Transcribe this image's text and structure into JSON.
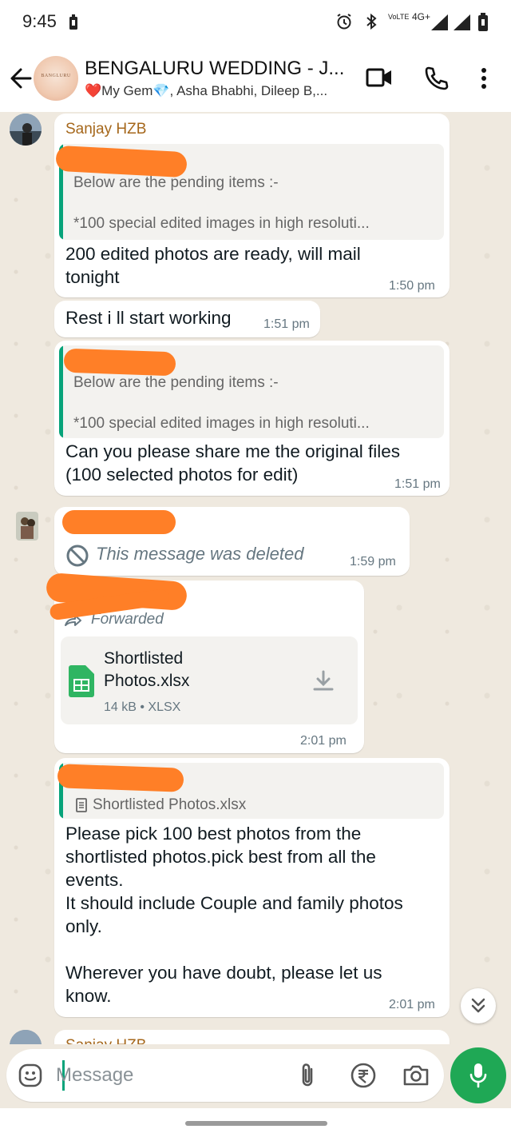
{
  "status_bar": {
    "time": "9:45",
    "network": "4G+",
    "volte": "VoLTE"
  },
  "header": {
    "title": "BENGALURU WEDDING - J...",
    "subtitle": "❤️My Gem💎, Asha Bhabhi, Dileep B,...",
    "avatar_text": "BANGLURU"
  },
  "messages": [
    {
      "sender": "Sanjay HZB",
      "quote_line1": "Below are the pending items :-",
      "quote_line2": "*100 special edited images in high resoluti...",
      "text_line1": "200 edited photos are ready, will mail",
      "text_line2": "tonight",
      "time": "1:50 pm"
    },
    {
      "text": "Rest i ll start working",
      "time": "1:51 pm"
    },
    {
      "quote_line1": "Below are the pending items :-",
      "quote_line2": "*100 special edited images in high resoluti...",
      "text_line1": "Can you please share me the original files",
      "text_line2": "(100 selected photos for edit)",
      "time": "1:51 pm"
    },
    {
      "deleted_text": "This message was deleted",
      "time": "1:59 pm"
    },
    {
      "forwarded_label": "Forwarded",
      "doc_name_line1": "Shortlisted",
      "doc_name_line2": "Photos.xlsx",
      "doc_meta": "14 kB • XLSX",
      "time": "2:01 pm"
    },
    {
      "quote_doc": "Shortlisted Photos.xlsx",
      "lines": [
        "Please pick 100 best photos from the",
        "shortlisted photos.pick best from all the",
        "events.",
        "It should include Couple and family photos",
        "only.",
        "",
        "Wherever you have doubt, please let us",
        "know."
      ],
      "time": "2:01 pm"
    },
    {
      "sender": "Sanjay HZB"
    }
  ],
  "input": {
    "placeholder": "Message"
  },
  "colors": {
    "accent": "#1fa855",
    "sender": "#a5671b",
    "quote_bar": "#07a37a",
    "redaction": "#ff7f27",
    "chat_bg": "#efe9df"
  },
  "icons": [
    "back-arrow-icon",
    "video-call-icon",
    "phone-icon",
    "more-vert-icon",
    "emoji-icon",
    "attach-icon",
    "rupee-icon",
    "camera-icon",
    "mic-icon",
    "spreadsheet-icon",
    "download-icon",
    "blocked-icon",
    "forward-icon",
    "double-chevron-down-icon"
  ]
}
